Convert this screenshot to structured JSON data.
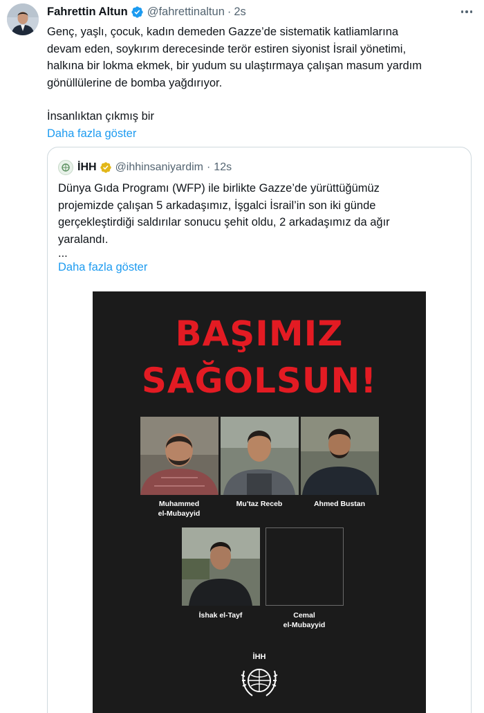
{
  "tweet": {
    "author_name": "Fahrettin Altun",
    "handle": "@fahrettinaltun",
    "separator": "·",
    "time": "2s",
    "lines": [
      "Genç, yaşlı, çocuk, kadın demeden Gazze’de sistematik katliamlarına",
      "devam eden, soykırım derecesinde terör estiren siyonist İsrail yönetimi,",
      "halkına bir lokma ekmek, bir yudum su ulaştırmaya çalışan masum yardım",
      "gönüllülerine de bomba yağdırıyor."
    ],
    "truncated_line": "İnsanlıktan çıkmış bir",
    "show_more": "Daha fazla göster",
    "verified_color": "#1d9bf0"
  },
  "quote": {
    "author_name": "İHH",
    "handle": "@ihhinsaniyardim",
    "separator": "·",
    "time": "12s",
    "lines": [
      "Dünya Gıda Programı (WFP) ile birlikte Gazze’de yürüttüğümüz",
      "projemizde çalışan 5 arkadaşımız, İşgalci İsrail’in son iki günde",
      "gerçekleştirdiği saldırılar sonucu şehit oldu, 2 arkadaşımız da ağır",
      "yaralandı."
    ],
    "ellipsis": "...",
    "show_more": "Daha fazla göster",
    "verified_color": "#e2b719",
    "poster": {
      "headline_1": "BAŞIMIZ",
      "headline_2": "SAĞOLSUN!",
      "headline_color": "#e31b23",
      "people": [
        {
          "name_line1": "Muhammed",
          "name_line2": "el-Mubayyid"
        },
        {
          "name_line1": "Mu'taz Receb",
          "name_line2": ""
        },
        {
          "name_line1": "Ahmed Bustan",
          "name_line2": ""
        },
        {
          "name_line1": "İshak el-Tayf",
          "name_line2": ""
        },
        {
          "name_line1": "Cemal",
          "name_line2": "el-Mubayyid"
        }
      ],
      "logo_text": "İHH"
    }
  }
}
